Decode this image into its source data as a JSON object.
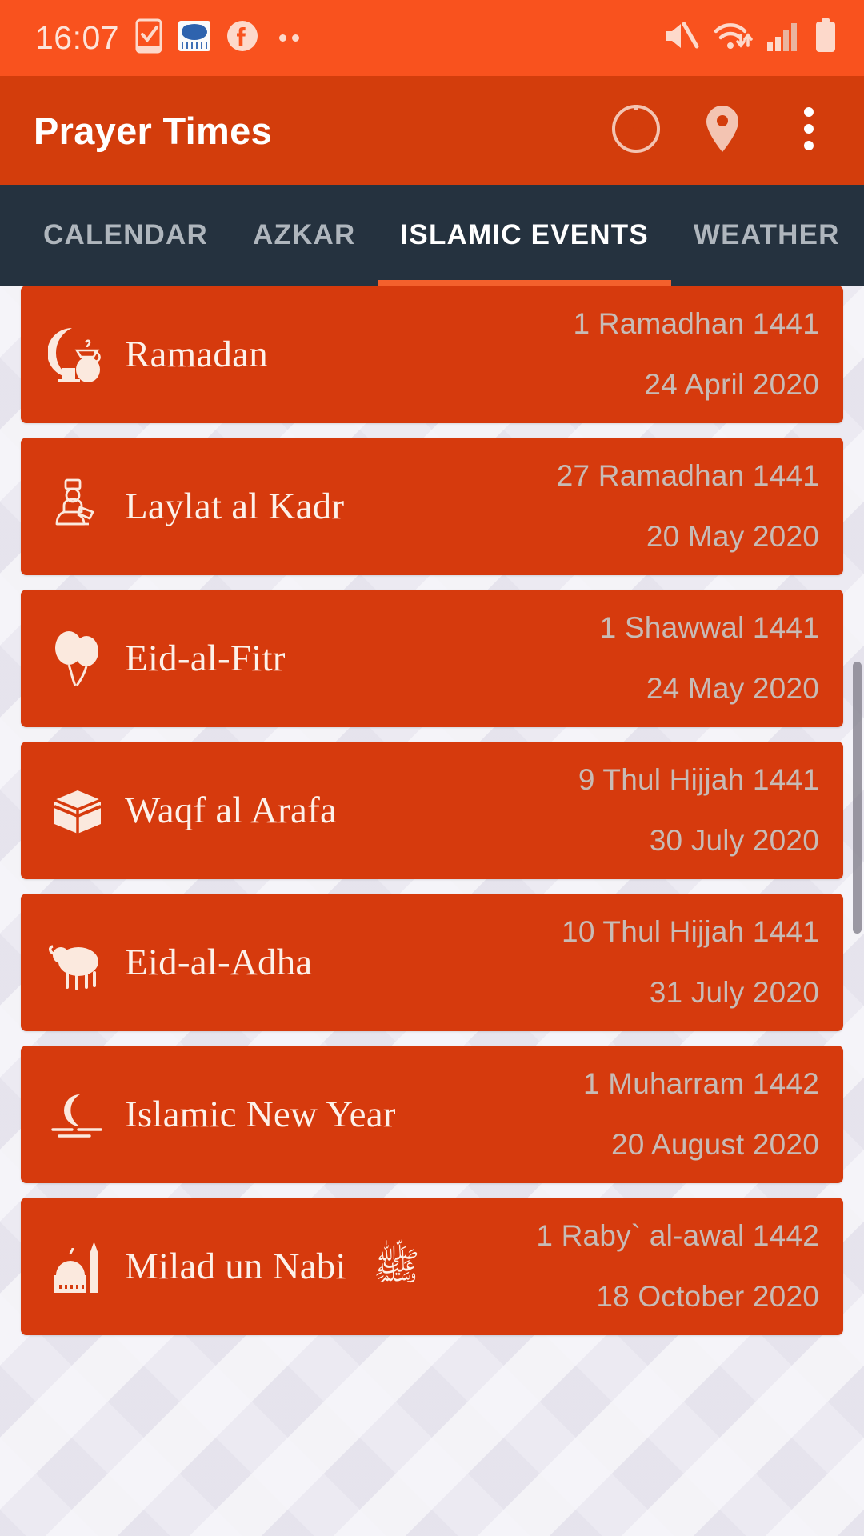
{
  "status_bar": {
    "time": "16:07",
    "left_icons": [
      "task-checkbox-icon",
      "weather-rain-icon",
      "facebook-icon",
      "more-notifications-dots"
    ],
    "right_icons": [
      "mute-icon",
      "wifi-icon",
      "cellular-signal-icon",
      "battery-icon"
    ],
    "background_color": "#F9521E"
  },
  "app_bar": {
    "title": "Prayer Times",
    "background_color": "#D33D0C",
    "actions": [
      {
        "name": "qibla-compass-button",
        "icon": "compass-icon"
      },
      {
        "name": "location-button",
        "icon": "location-pin-icon"
      },
      {
        "name": "overflow-menu-button",
        "icon": "more-vertical-icon"
      }
    ]
  },
  "tabs": {
    "background_color": "#25323F",
    "indicator_color": "#F4602C",
    "active_index": 2,
    "items": [
      {
        "label": "CALENDAR"
      },
      {
        "label": "AZKAR"
      },
      {
        "label": "ISLAMIC EVENTS"
      },
      {
        "label": "WEATHER"
      }
    ]
  },
  "events": {
    "card_color": "#D63A0D",
    "date_text_color": "#C8BBB5",
    "items": [
      {
        "name": "Ramadan",
        "icon": "crescent-moon-teapot-icon",
        "hijri_date": "1 Ramadhan 1441",
        "gregorian_date": "24 April 2020",
        "suffix": ""
      },
      {
        "name": "Laylat al Kadr",
        "icon": "praying-person-icon",
        "hijri_date": "27 Ramadhan 1441",
        "gregorian_date": "20 May 2020",
        "suffix": ""
      },
      {
        "name": "Eid-al-Fitr",
        "icon": "balloons-icon",
        "hijri_date": "1 Shawwal 1441",
        "gregorian_date": "24 May 2020",
        "suffix": ""
      },
      {
        "name": "Waqf al Arafa",
        "icon": "kaaba-icon",
        "hijri_date": "9 Thul Hijjah 1441",
        "gregorian_date": "30 July 2020",
        "suffix": ""
      },
      {
        "name": "Eid-al-Adha",
        "icon": "sheep-icon",
        "hijri_date": "10 Thul Hijjah 1441",
        "gregorian_date": "31 July 2020",
        "suffix": ""
      },
      {
        "name": "Islamic New Year",
        "icon": "crescent-horizon-icon",
        "hijri_date": "1 Muharram 1442",
        "gregorian_date": "20 August 2020",
        "suffix": ""
      },
      {
        "name": "Milad un Nabi",
        "icon": "mosque-icon",
        "hijri_date": "1 Raby` al-awal 1442",
        "gregorian_date": "18 October 2020",
        "suffix": "ﷺ"
      }
    ]
  }
}
